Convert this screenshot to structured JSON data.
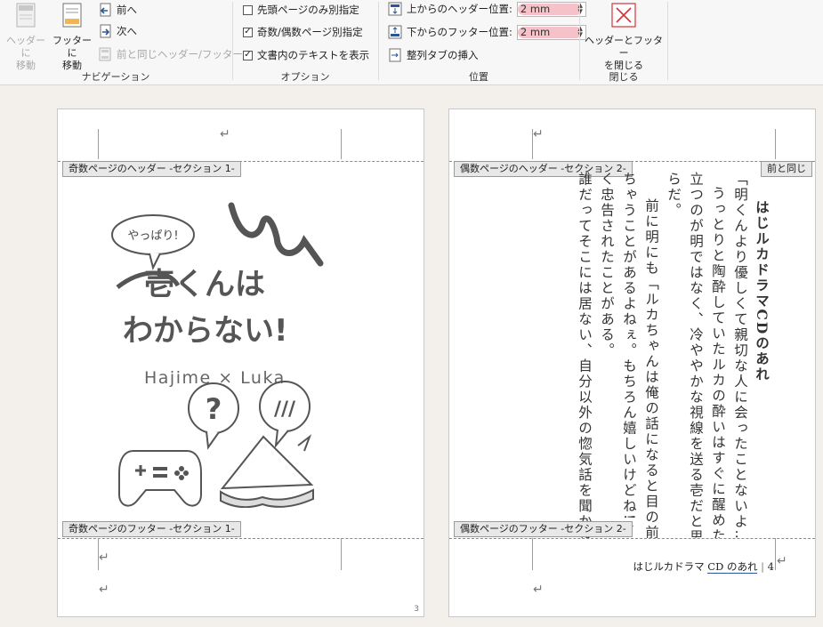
{
  "ribbon": {
    "navigation": {
      "goto_header": "ヘッダーに\n移動",
      "goto_footer": "フッターに\n移動",
      "previous": "前へ",
      "next": "次へ",
      "link_previous": "前と同じヘッダー/フッター",
      "group_label": "ナビゲーション"
    },
    "options": {
      "different_first_page": {
        "label": "先頭ページのみ別指定",
        "checked": false
      },
      "different_odd_even": {
        "label": "奇数/偶数ページ別指定",
        "checked": true
      },
      "show_document_text": {
        "label": "文書内のテキストを表示",
        "checked": true
      },
      "group_label": "オプション"
    },
    "position": {
      "header_from_top_label": "上からのヘッダー位置:",
      "header_from_top_value": "2 mm",
      "footer_from_bottom_label": "下からのフッター位置:",
      "footer_from_bottom_value": "2 mm",
      "insert_alignment_tab": "整列タブの挿入",
      "group_label": "位置"
    },
    "close": {
      "close_button": "ヘッダーとフッター\nを閉じる",
      "group_label": "閉じる"
    },
    "colors": {
      "accent": "#2b579a",
      "close_red": "#d13438",
      "highlight": "#f4c2c8"
    }
  },
  "left_page": {
    "header_tag": "奇数ページのヘッダー -セクション 1-",
    "footer_tag": "奇数ページのフッター -セクション 1-",
    "page_number": "3",
    "illustration": {
      "speech_bubble": "やっぱり!",
      "title_line1": "壱くんは",
      "title_line2": "わからない!",
      "subtitle": "Hajime × Luka",
      "bubble_question": "?",
      "bubble_slashes": "///"
    }
  },
  "right_page": {
    "header_tag": "偶数ページのヘッダー -セクション 2-",
    "same_as_previous_tag": "前と同じ",
    "footer_tag": "偶数ページのフッター -セクション 2-",
    "footer_text_prefix": "はじルカドラマ ",
    "footer_text_cd": "CD",
    "footer_text_suffix": " のあれ",
    "footer_separator": "|",
    "footer_page_number": "4",
    "columns": [
      "はじルカドラマCDのあれ",
      "「明くんより優しくて親切な人に会ったことないよ……!」",
      "うっとりと陶酔していたルカの酔いはすぐに醒めた。目の前に",
      "立つのが明ではなく、冷ややかな視線を送る壱だと思い出したか",
      "らだ。",
      "前に明にも「ルカちゃんは俺の話になると目の前が見えなくな",
      "ちゃうことがあるよねぇ。もちろん嬉しいけどね!」とそれと",
      "く忠告されたことがある。",
      "誰だってそこには居ない、自分以外の惚気話を聞かされたら"
    ]
  }
}
